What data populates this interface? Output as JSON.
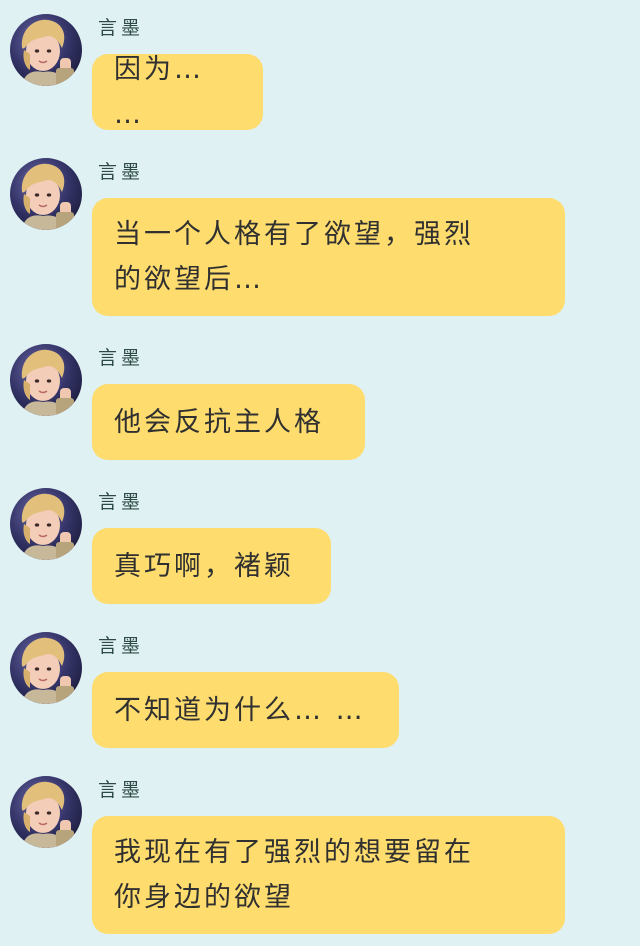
{
  "colors": {
    "background": "#dff1f2",
    "bubble": "#fedc6e",
    "text": "#303030",
    "name": "#2e4a46"
  },
  "messages": [
    {
      "sender": "言墨",
      "avatar_icon": "user-avatar-icon",
      "text": "因为… …"
    },
    {
      "sender": "言墨",
      "avatar_icon": "user-avatar-icon",
      "text": "当一个人格有了欲望，强烈\n的欲望后…"
    },
    {
      "sender": "言墨",
      "avatar_icon": "user-avatar-icon",
      "text": "他会反抗主人格"
    },
    {
      "sender": "言墨",
      "avatar_icon": "user-avatar-icon",
      "text": "真巧啊，褚颖"
    },
    {
      "sender": "言墨",
      "avatar_icon": "user-avatar-icon",
      "text": "不知道为什么… …"
    },
    {
      "sender": "言墨",
      "avatar_icon": "user-avatar-icon",
      "text": "我现在有了强烈的想要留在\n你身边的欲望"
    }
  ]
}
